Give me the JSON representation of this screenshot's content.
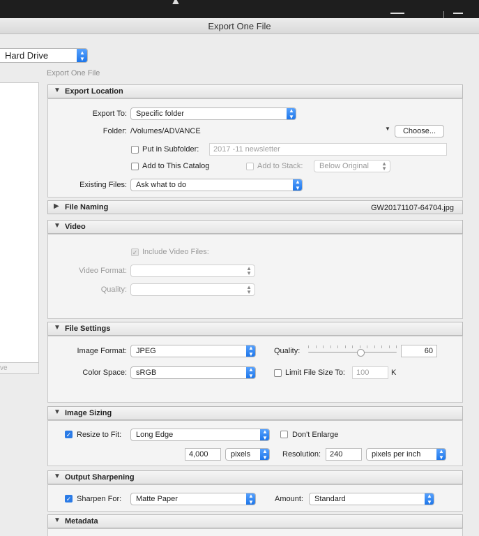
{
  "window": {
    "title": "Export One File",
    "top_glyph": "▲"
  },
  "left": {
    "export_to_value": "Hard Drive",
    "panel_footer": "ve"
  },
  "breadcrumb": "Export One File",
  "sections": {
    "export_location": "Export Location",
    "file_naming": "File Naming",
    "file_naming_value": "GW20171107-64704.jpg",
    "video": "Video",
    "file_settings": "File Settings",
    "image_sizing": "Image Sizing",
    "output_sharpening": "Output Sharpening",
    "metadata": "Metadata"
  },
  "export_location": {
    "export_to_label": "Export To:",
    "export_to_value": "Specific folder",
    "folder_label": "Folder:",
    "folder_value": "/Volumes/ADVANCE",
    "choose_label": "Choose...",
    "subfolder_label": "Put in Subfolder:",
    "subfolder_value": "2017 -11 newsletter",
    "add_catalog_label": "Add to This Catalog",
    "add_stack_label": "Add to Stack:",
    "stack_value": "Below Original",
    "existing_label": "Existing Files:",
    "existing_value": "Ask what to do"
  },
  "video": {
    "include_label": "Include Video Files:",
    "format_label": "Video Format:",
    "quality_label": "Quality:"
  },
  "file_settings": {
    "format_label": "Image Format:",
    "format_value": "JPEG",
    "quality_label": "Quality:",
    "quality_value": "60",
    "quality_level": 0.6,
    "colorspace_label": "Color Space:",
    "colorspace_value": "sRGB",
    "limit_label": "Limit File Size To:",
    "limit_value": "100",
    "limit_unit": "K"
  },
  "image_sizing": {
    "resize_label": "Resize to Fit:",
    "resize_value": "Long Edge",
    "dont_enlarge_label": "Don't Enlarge",
    "size_value": "4,000",
    "units_value": "pixels",
    "resolution_label": "Resolution:",
    "resolution_value": "240",
    "res_units_value": "pixels per inch"
  },
  "output_sharpening": {
    "sharpen_label": "Sharpen For:",
    "sharpen_value": "Matte Paper",
    "amount_label": "Amount:",
    "amount_value": "Standard"
  },
  "colors": {
    "accent": "#2b7be6",
    "titlebar": "#e0e0e0",
    "topbar": "#1e1e1e"
  }
}
